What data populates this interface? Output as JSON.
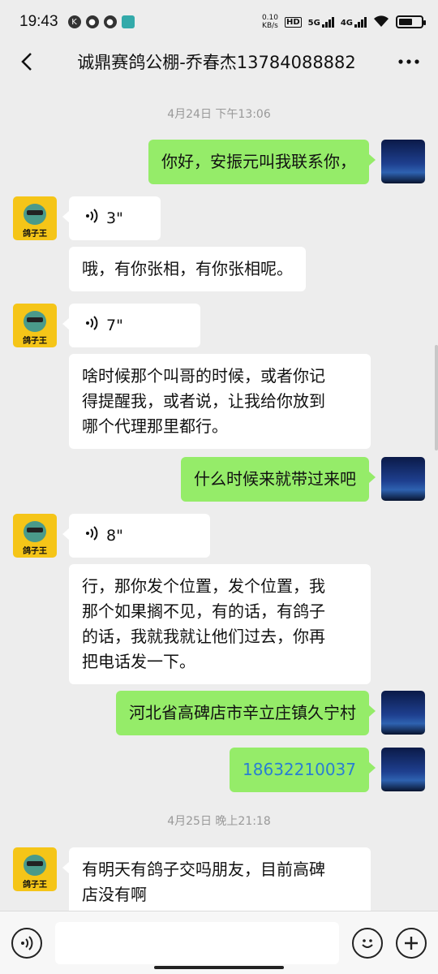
{
  "status_bar": {
    "time": "19:43",
    "speed_value": "0.10",
    "speed_unit": "KB/s",
    "hd_badge": "HD",
    "net_5g": "5G",
    "net_4g": "4G"
  },
  "nav": {
    "title": "诚鼎赛鸽公棚-乔春杰13784088882"
  },
  "avatar_label": "鸽子王",
  "messages": [
    {
      "type": "timestamp",
      "text": "4月24日 下午13:06"
    },
    {
      "type": "text",
      "side": "right",
      "text": "你好，安振元叫我联系你，"
    },
    {
      "type": "voice",
      "side": "left",
      "duration": "3\""
    },
    {
      "type": "text",
      "side": "left",
      "text": "哦，有你张相，有你张相呢。"
    },
    {
      "type": "voice",
      "side": "left",
      "duration": "7\""
    },
    {
      "type": "text",
      "side": "left",
      "lines": [
        "啥时候那个叫哥的时候，或者你记",
        "得提醒我，或者说，让我给你放到",
        "哪个代理那里都行。"
      ]
    },
    {
      "type": "text",
      "side": "right",
      "text": "什么时候来就带过来吧"
    },
    {
      "type": "voice",
      "side": "left",
      "duration": "8\""
    },
    {
      "type": "text",
      "side": "left",
      "lines": [
        "行，那你发个位置，发个位置，我",
        "那个如果搁不见，有的话，有鸽子",
        "的话，我就我就让他们过去，你再",
        "把电话发一下。"
      ]
    },
    {
      "type": "text",
      "side": "right",
      "text": "河北省高碑店市辛立庄镇久宁村"
    },
    {
      "type": "text",
      "side": "right",
      "text": "18632210037"
    },
    {
      "type": "timestamp",
      "text": "4月25日 晚上21:18"
    },
    {
      "type": "text",
      "side": "left",
      "lines": [
        "有明天有鸽子交吗朋友，目前高碑",
        "店没有啊"
      ]
    }
  ],
  "icons": {
    "back": "chevron-left-icon",
    "more": "more-dots-icon",
    "voice_input": "voice-input-icon",
    "emoji": "emoji-icon",
    "plus": "plus-icon"
  }
}
